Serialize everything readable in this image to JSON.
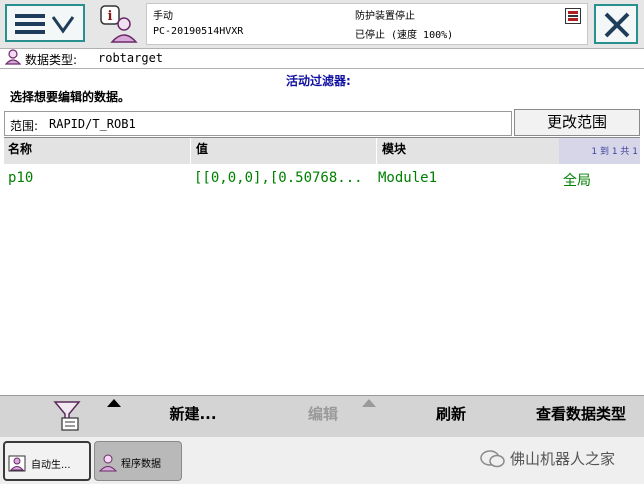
{
  "status": {
    "mode": "手动",
    "controller_name": "PC-20190514HVXR",
    "safety_state": "防护装置停止",
    "run_state": "已停止 (速度 100%)"
  },
  "data_type": {
    "label": "数据类型:",
    "value": "robtarget"
  },
  "instruction": "选择想要编辑的数据。",
  "active_filter_label": "活动过滤器:",
  "scope": {
    "label": "范围:",
    "value": "RAPID/T_ROB1",
    "change_button": "更改范围"
  },
  "table": {
    "columns": [
      "名称",
      "值",
      "模块"
    ],
    "pager": "1 到 1 共 1",
    "rows": [
      {
        "name": "p10",
        "value": "[[0,0,0],[0.50768...",
        "module": "Module1",
        "scope": "全局"
      }
    ]
  },
  "commands": {
    "new": "新建...",
    "edit": "编辑",
    "refresh": "刷新",
    "view_types": "查看数据类型"
  },
  "taskbar": {
    "item1": "自动生...",
    "item2": "程序数据",
    "watermark": "佛山机器人之家"
  },
  "colors": {
    "accent": "#2a8f8f",
    "data_green": "#008000",
    "filter_blue": "#1010a0"
  }
}
